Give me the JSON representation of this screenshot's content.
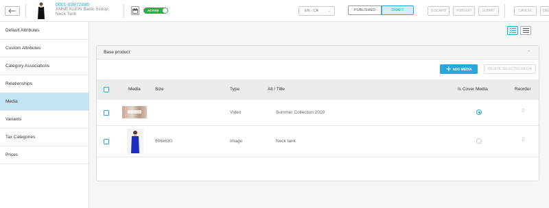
{
  "header": {
    "sku": "0001-83872446",
    "product_name": "ANNE KLEIN Basic Scoop Neck Tank",
    "status_label": "ACTIVE",
    "locale": "EN - CA",
    "published_label": "PUBLISHED",
    "draft_label": "DRAFT",
    "discard_label": "DISCARD",
    "publish_label": "PUBLISH",
    "submit_label": "SUBMIT",
    "cancel_label": "CANCEL",
    "delete_label": "DEL"
  },
  "sidebar": {
    "items": [
      {
        "label": "Default Attributes"
      },
      {
        "label": "Custom Attributes"
      },
      {
        "label": "Category Associations"
      },
      {
        "label": "Relationships"
      },
      {
        "label": "Media"
      },
      {
        "label": "Variants"
      },
      {
        "label": "Tax Categories"
      },
      {
        "label": "Prices"
      }
    ],
    "selected": "Media"
  },
  "panel": {
    "title": "Base product",
    "add_label": "ADD MEDIA",
    "delete_selected_label": "DELETE SELECTED MEDIA",
    "columns": {
      "media": "Media",
      "size": "Size",
      "type": "Type",
      "alt": "Alt / Title",
      "cover": "Is Cover Media",
      "reorder": "Reorder"
    },
    "rows": [
      {
        "size": "",
        "type": "Video",
        "alt": "Summer Collection 2019",
        "is_cover": true
      },
      {
        "size": "506x630",
        "type": "Image",
        "alt": "Neck tank",
        "is_cover": false
      }
    ]
  },
  "colors": {
    "accent": "#2aa7dc",
    "active": "#25b14a",
    "selected_row": "#c3e4f2"
  }
}
